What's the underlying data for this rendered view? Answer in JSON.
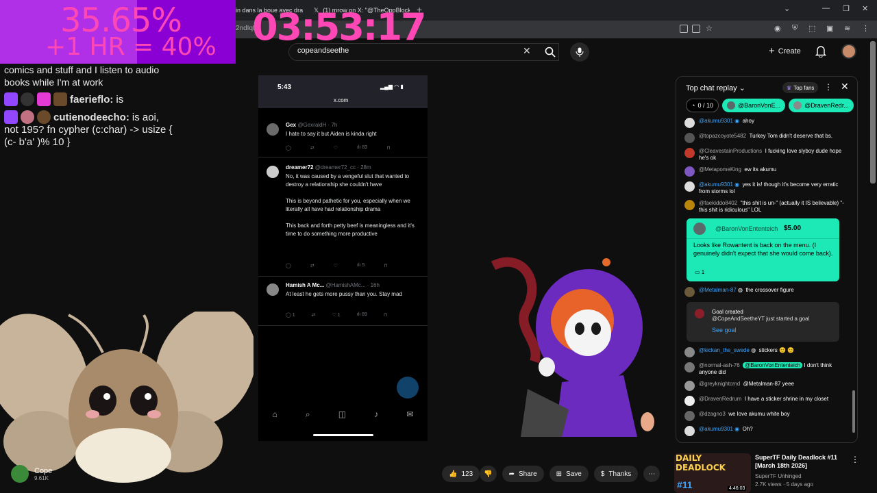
{
  "browser": {
    "tabs": [
      {
        "label": "in dans la boue avec dra"
      },
      {
        "label": "(1) mrow on X: \"@TheOppBlock"
      }
    ],
    "address_fragment": "2ndIqR"
  },
  "overlay": {
    "stat1": "35.65%",
    "stat2": "+1 HR = 40%",
    "timer": "03:53:17",
    "chat_log": {
      "prev_lines": [
        "comics and stuff and I listen to audio",
        "books while I'm at work"
      ],
      "msg1": {
        "user": "faerieflo:",
        "text": "is"
      },
      "msg2": {
        "user": "cutienodeecho:",
        "text": "is aoi,",
        "lines": [
          "not 195? fn cypher (c:char) -> usize {",
          "(c- b'a' )% 10 }"
        ]
      }
    }
  },
  "header": {
    "search_value": "copeandseethe",
    "create_label": "Create"
  },
  "phone": {
    "time": "5:43",
    "url": "x.com",
    "tweets": [
      {
        "name": "Gex",
        "handle": "@GexraldH · 7h",
        "body": "I hate to say it but Aiden is kinda right",
        "views": "83"
      },
      {
        "name": "dreamer72",
        "handle": "@dreamer72_cc · 28m",
        "body": "No, it was caused by a vengeful slut that wanted to destroy a relationship she couldn't have\n\nThis is beyond pathetic for you, especially when we literally all have had relationship drama\n\nThis back and forth petty beef is meaningless and it's time to do something more productive",
        "likes": "5"
      },
      {
        "name": "Hamish A Mc...",
        "handle": "@HamishAMc... · 16h",
        "body": "At least he gets more pussy than you. Stay mad",
        "replies": "1",
        "likes": "1",
        "views": "89"
      }
    ]
  },
  "video_actions": {
    "channel_name": "Cope",
    "channel_subs": "9.61K",
    "likes": "123",
    "share": "Share",
    "save": "Save",
    "thanks": "Thanks"
  },
  "chat": {
    "title": "Top chat replay",
    "top_fans": "Top fans",
    "goal_progress": "0 / 10",
    "pill1": "@BaronVonE...",
    "pill2": "@DravenRedr...",
    "messages": [
      {
        "user": "@akumu9301",
        "text": "ahoy",
        "color": "#3ea6ff"
      },
      {
        "user": "@topazcoyote5482",
        "text": "Turkey Tom didn't deserve that bs.",
        "color": "#aaa"
      },
      {
        "user": "@CleavestainProductions",
        "text": "I fucking love slyboy dude hope he's ok",
        "color": "#aaa"
      },
      {
        "user": "@MetapomeKing",
        "text": "ew its akumu",
        "color": "#aaa"
      },
      {
        "user": "@akumu9301",
        "text": "yes it is! though it's become very erratic from storms lol",
        "color": "#3ea6ff"
      },
      {
        "user": "@faekiddo8402",
        "text": "\"this shit is un-\" (actually it IS believable) \"-this shit is ridiculous\" LOL",
        "color": "#aaa"
      }
    ],
    "superchat": {
      "user": "@BaronVonEntenteich",
      "amount": "$5.00",
      "text": "Looks like Rowantent is back on the menu. (I genuinely didn't expect that she would come back).",
      "replies": "1"
    },
    "msg_after_sc": {
      "user": "@Metalman-87",
      "text": "the crossover figure"
    },
    "goal": {
      "title": "Goal created",
      "subtitle": "@CopeAndSeetheYT just started a goal",
      "link": "See goal"
    },
    "messages2": [
      {
        "user": "@kickan_the_swede",
        "text": "stickers 😊 😊"
      },
      {
        "user": "@normal-ash-76",
        "mention": "@BaronVonEntenteich",
        "text": "I don't think anyone did"
      },
      {
        "user": "@greyknightcmd",
        "text": "@Metalman-87 yeee"
      },
      {
        "user": "@DravenRedrum",
        "text": "I have a sticker shrine in my closet"
      },
      {
        "user": "@dzagno3",
        "text": "we love akumu white boy"
      },
      {
        "user": "@akumu9301",
        "text": "Oh?"
      }
    ]
  },
  "recommendation": {
    "thumb_title": "DAILY DEADLOCK",
    "thumb_num": "#11",
    "duration": "4:46:03",
    "title": "SuperTF Daily Deadlock #11 [March 18th 2026]",
    "channel": "SuperTF Unhinged",
    "meta": "2.7K views · 5 days ago"
  },
  "colors": {
    "superchat": "#1de9b6",
    "overlay_pink": "#ff47b5",
    "overlay_purple": "#8a00d4",
    "link": "#3ea6ff"
  }
}
